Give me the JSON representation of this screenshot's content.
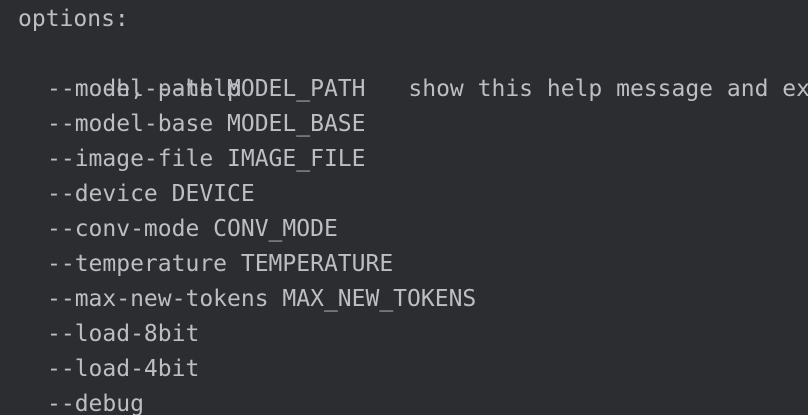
{
  "header": "options:",
  "help_option": {
    "flag": "-h, --help",
    "description": "show this help message and exit"
  },
  "options": [
    "--model-path MODEL_PATH",
    "--model-base MODEL_BASE",
    "--image-file IMAGE_FILE",
    "--device DEVICE",
    "--conv-mode CONV_MODE",
    "--temperature TEMPERATURE",
    "--max-new-tokens MAX_NEW_TOKENS",
    "--load-8bit",
    "--load-4bit",
    "--debug"
  ],
  "colors": {
    "background": "#2b2d30",
    "text": "#bcbec4"
  }
}
